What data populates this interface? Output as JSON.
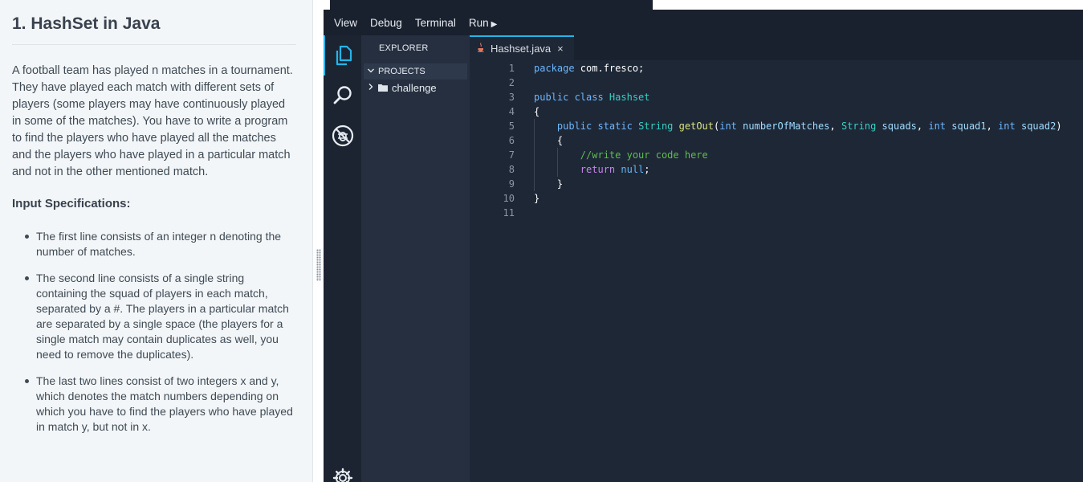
{
  "problem": {
    "title": "1. HashSet in Java",
    "description": "A football team has played n matches in a tournament. They have played each match with different sets of players (some players may have continuously played in some of the matches). You have to write a program to find the players who have played all the matches and the players who have played in a particular match and not in the other mentioned match.",
    "input_heading": "Input Specifications:",
    "specs": [
      "The first line consists of an integer n denoting the number of matches.",
      "The second line consists of a single string containing the squad of players in each match, separated by a #. The players in a particular match are separated by a single space (the players for a single match may contain duplicates as well, you need to remove the duplicates).",
      "The last two lines consist of two integers x and y, which denotes the match numbers depending on which you have to find the players who have played in match y, but not in x."
    ]
  },
  "menu": {
    "items": [
      "View",
      "Debug",
      "Terminal",
      "Run"
    ],
    "run_icon": "▶"
  },
  "activity_bar": {
    "icons": [
      "explorer-icon",
      "search-icon",
      "debug-icon",
      "settings-icon"
    ]
  },
  "sidebar": {
    "title": "EXPLORER",
    "section": "PROJECTS",
    "folders": [
      {
        "name": "challenge",
        "icon": "folder-icon"
      }
    ]
  },
  "editor": {
    "tab": {
      "filename": "Hashset.java",
      "close": "×",
      "icon": "java-icon"
    },
    "line_numbers": [
      "1",
      "2",
      "3",
      "4",
      "5",
      "6",
      "7",
      "8",
      "9",
      "10",
      "11"
    ],
    "code": [
      [
        [
          "kw",
          "package"
        ],
        [
          "plain",
          " com.fresco;"
        ]
      ],
      [],
      [
        [
          "kw",
          "public class "
        ],
        [
          "type",
          "Hashset"
        ]
      ],
      [
        [
          "plain",
          "{"
        ]
      ],
      [
        [
          "plain",
          "    "
        ],
        [
          "kw",
          "public static "
        ],
        [
          "type",
          "String "
        ],
        [
          "fn",
          "getOut"
        ],
        [
          "plain",
          "("
        ],
        [
          "kw",
          "int "
        ],
        [
          "param",
          "numberOfMatches"
        ],
        [
          "plain",
          ", "
        ],
        [
          "type",
          "String "
        ],
        [
          "param",
          "squads"
        ],
        [
          "plain",
          ", "
        ],
        [
          "kw",
          "int "
        ],
        [
          "param",
          "squad1"
        ],
        [
          "plain",
          ", "
        ],
        [
          "kw",
          "int "
        ],
        [
          "param",
          "squad2"
        ],
        [
          "plain",
          ")"
        ]
      ],
      [
        [
          "plain",
          "    {"
        ]
      ],
      [
        [
          "plain",
          "        "
        ],
        [
          "cm",
          "//write your code here"
        ]
      ],
      [
        [
          "plain",
          "        "
        ],
        [
          "ret",
          "return "
        ],
        [
          "null",
          "null"
        ],
        [
          "plain",
          ";"
        ]
      ],
      [
        [
          "plain",
          "    }"
        ]
      ],
      [
        [
          "plain",
          "}"
        ]
      ],
      []
    ]
  },
  "colors": {
    "accent": "#23b5e8",
    "editor_bg": "#1e2736",
    "keyword": "#6cb7ff",
    "type": "#36d0c5",
    "function": "#dbe47f",
    "comment": "#5fbe4f",
    "return_keyword": "#c387e6"
  }
}
